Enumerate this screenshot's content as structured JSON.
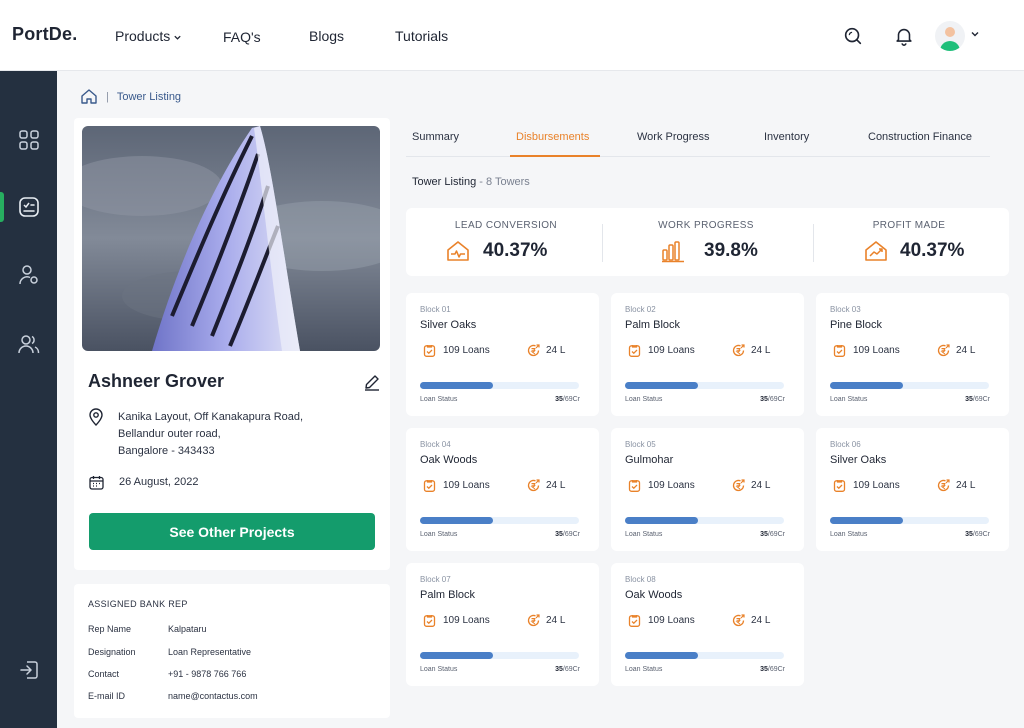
{
  "colors": {
    "accent": "#e9822a",
    "primary_button": "#149c6c",
    "sidebar": "#243040",
    "progress": "#4a7fc7",
    "link": "#3a5a8c"
  },
  "nav": {
    "logo": "PortDe.",
    "links": [
      "Products",
      "FAQ's",
      "Blogs",
      "Tutorials"
    ],
    "icons": [
      "search-icon",
      "bell-icon",
      "avatar",
      "chevron-down-icon"
    ]
  },
  "sidebar": {
    "items": [
      "grid-icon",
      "dashboard-icon",
      "user-settings-icon",
      "users-icon",
      "logout-icon"
    ],
    "active_index": 1
  },
  "breadcrumb": {
    "current": "Tower Listing"
  },
  "profile": {
    "name": "Ashneer Grover",
    "address_lines": [
      "Kanika Layout, Off Kanakapura Road,",
      "Bellandur outer road,",
      "Bangalore - 343433"
    ],
    "date": "26 August, 2022",
    "button": "See Other Projects"
  },
  "bank_rep": {
    "title": "ASSIGNED BANK REP",
    "rows": [
      {
        "label": "Rep Name",
        "value": "Kalpataru"
      },
      {
        "label": "Designation",
        "value": "Loan Representative"
      },
      {
        "label": "Contact",
        "value": "+91 - 9878 766 766"
      },
      {
        "label": "E-mail ID",
        "value": "name@contactus.com"
      }
    ]
  },
  "tabs": {
    "items": [
      "Summary",
      "Disbursements",
      "Work Progress",
      "Inventory",
      "Construction Finance"
    ],
    "active": "Disbursements"
  },
  "listing": {
    "title": "Tower Listing",
    "count": "- 8 Towers"
  },
  "stats": [
    {
      "label": "LEAD CONVERSION",
      "value": "40.37%",
      "icon": "house-pulse-icon"
    },
    {
      "label": "WORK PROGRESS",
      "value": "39.8%",
      "icon": "bar-chart-icon"
    },
    {
      "label": "PROFIT MADE",
      "value": "40.37%",
      "icon": "house-trend-icon"
    }
  ],
  "blocks": [
    {
      "id": "Block 01",
      "name": "Silver Oaks",
      "loans": "109 Loans",
      "amount": "24 L",
      "status_label": "Loan Status",
      "status_done": "35",
      "status_total": "/69Cr",
      "progress": 0.46
    },
    {
      "id": "Block 02",
      "name": "Palm Block",
      "loans": "109 Loans",
      "amount": "24 L",
      "status_label": "Loan Status",
      "status_done": "35",
      "status_total": "/69Cr",
      "progress": 0.46
    },
    {
      "id": "Block 03",
      "name": "Pine Block",
      "loans": "109 Loans",
      "amount": "24 L",
      "status_label": "Loan Status",
      "status_done": "35",
      "status_total": "/69Cr",
      "progress": 0.46
    },
    {
      "id": "Block 04",
      "name": "Oak Woods",
      "loans": "109 Loans",
      "amount": "24 L",
      "status_label": "Loan Status",
      "status_done": "35",
      "status_total": "/69Cr",
      "progress": 0.46
    },
    {
      "id": "Block 05",
      "name": "Gulmohar",
      "loans": "109 Loans",
      "amount": "24 L",
      "status_label": "Loan Status",
      "status_done": "35",
      "status_total": "/69Cr",
      "progress": 0.46
    },
    {
      "id": "Block 06",
      "name": "Silver Oaks",
      "loans": "109 Loans",
      "amount": "24 L",
      "status_label": "Loan Status",
      "status_done": "35",
      "status_total": "/69Cr",
      "progress": 0.46
    },
    {
      "id": "Block 07",
      "name": "Palm Block",
      "loans": "109 Loans",
      "amount": "24 L",
      "status_label": "Loan Status",
      "status_done": "35",
      "status_total": "/69Cr",
      "progress": 0.46
    },
    {
      "id": "Block 08",
      "name": "Oak Woods",
      "loans": "109 Loans",
      "amount": "24 L",
      "status_label": "Loan Status",
      "status_done": "35",
      "status_total": "/69Cr",
      "progress": 0.46
    }
  ]
}
